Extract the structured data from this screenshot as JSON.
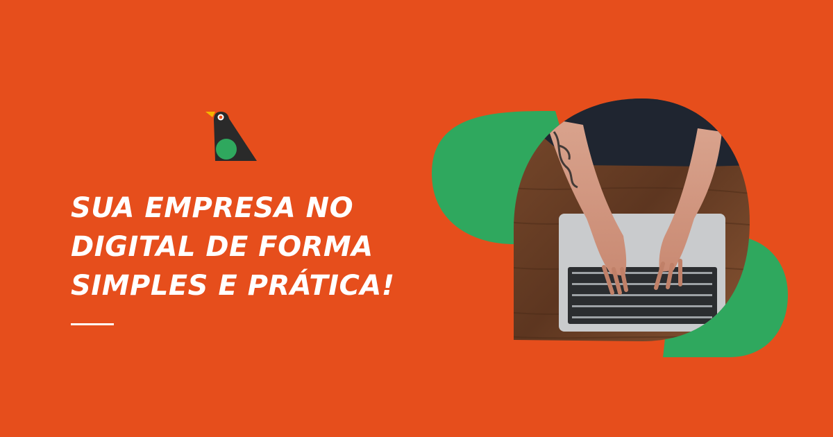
{
  "brand": {
    "logo_icon": "bird-logo-icon",
    "colors": {
      "background": "#e64e1c",
      "green": "#2fa85e",
      "dark": "#2a2a2a",
      "beak": "#f5b400"
    }
  },
  "headline": {
    "line1": "SUA EMPRESA NO",
    "line2": "DIGITAL DE FORMA",
    "line3": "SIMPLES E PRÁTICA!"
  },
  "illustration": {
    "subject": "hands-typing-on-laptop-photo"
  }
}
